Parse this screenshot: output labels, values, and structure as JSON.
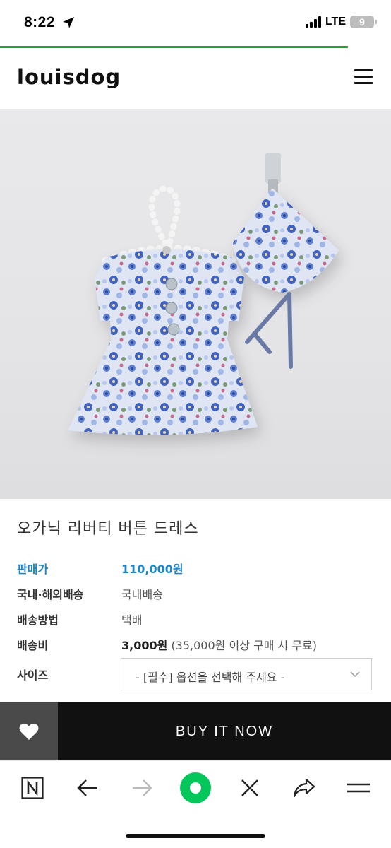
{
  "status_bar": {
    "time": "8:22",
    "network": "LTE",
    "battery": "9"
  },
  "header": {
    "logo": "louisdog"
  },
  "gallery": {
    "dot_count": 10,
    "active_index": 0
  },
  "product": {
    "title": "오가닉 리버티 버튼 드레스",
    "rows": [
      {
        "label": "판매가",
        "value": "110,000원"
      },
      {
        "label": "국내·해외배송",
        "value": "국내배송"
      },
      {
        "label": "배송방법",
        "value": "택배"
      },
      {
        "label": "배송비",
        "value_strong": "3,000원",
        "value_note": "(35,000원 이상 구매 시 무료)"
      }
    ],
    "size_label": "사이즈",
    "size_select_value": "- [필수] 옵션을 선택해 주세요 -"
  },
  "actions": {
    "buy_label": "BUY IT NOW"
  },
  "browser_toolbar": {
    "icons": [
      "naver-icon",
      "back-arrow-icon",
      "forward-arrow-icon",
      "green-home-icon",
      "close-icon",
      "share-icon",
      "menu-icon"
    ]
  },
  "colors": {
    "accent_price": "#1f86c6",
    "load_bar": "#1fa33a",
    "buy_bg": "#111111",
    "wish_bg": "#4a4a4a",
    "naver_green": "#03c75a"
  }
}
